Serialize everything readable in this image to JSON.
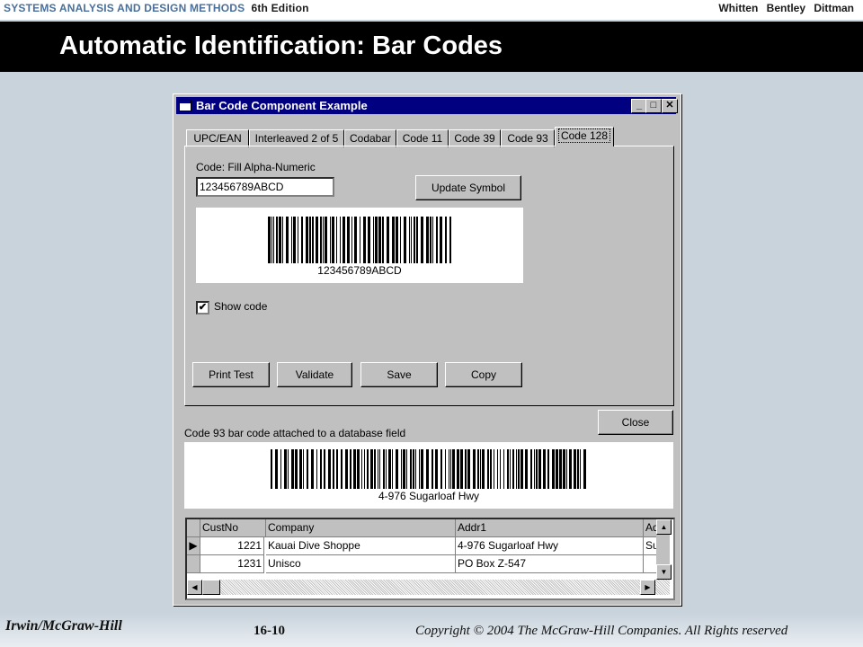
{
  "slide": {
    "header_left": "SYSTEMS ANALYSIS AND DESIGN METHODS",
    "header_edition": "6th Edition",
    "header_authors": "Whitten   Bentley   Dittman",
    "title": "Automatic Identification: Bar Codes",
    "footer_publisher": "Irwin/McGraw-Hill",
    "footer_page": "16-10",
    "footer_copyright": "Copyright © 2004 The McGraw-Hill Companies. All Rights reserved"
  },
  "window": {
    "title": "Bar Code Component Example",
    "controls": {
      "minimize": "_",
      "maximize": "□",
      "close": "✕"
    },
    "tabs": [
      "UPC/EAN",
      "Interleaved 2 of 5",
      "Codabar",
      "Code 11",
      "Code 39",
      "Code 93",
      "Code 128"
    ],
    "active_tab": "Code 128",
    "code_label": "Code: Fill Alpha-Numeric",
    "code_value": "123456789ABCD",
    "update_button": "Update Symbol",
    "symbol_text": "123456789ABCD",
    "show_code_label": "Show code",
    "show_code_checked": true,
    "action_buttons": [
      "Print Test",
      "Validate",
      "Save",
      "Copy"
    ],
    "close_button": "Close",
    "db_label": "Code 93 bar code attached to a database field",
    "db_symbol_text": "4-976 Sugarloaf Hwy"
  },
  "grid": {
    "columns": [
      "CustNo",
      "Company",
      "Addr1",
      "Ad"
    ],
    "rows": [
      {
        "selected": true,
        "cells": [
          "1221",
          "Kauai Dive Shoppe",
          "4-976 Sugarloaf Hwy",
          "Su"
        ]
      },
      {
        "selected": false,
        "cells": [
          "1231",
          "Unisco",
          "PO Box Z-547",
          ""
        ]
      }
    ]
  },
  "icons": [
    "window-app-icon",
    "row-pointer-icon",
    "scroll-up-arrow-icon",
    "scroll-down-arrow-icon",
    "scroll-left-arrow-icon",
    "scroll-right-arrow-icon"
  ]
}
